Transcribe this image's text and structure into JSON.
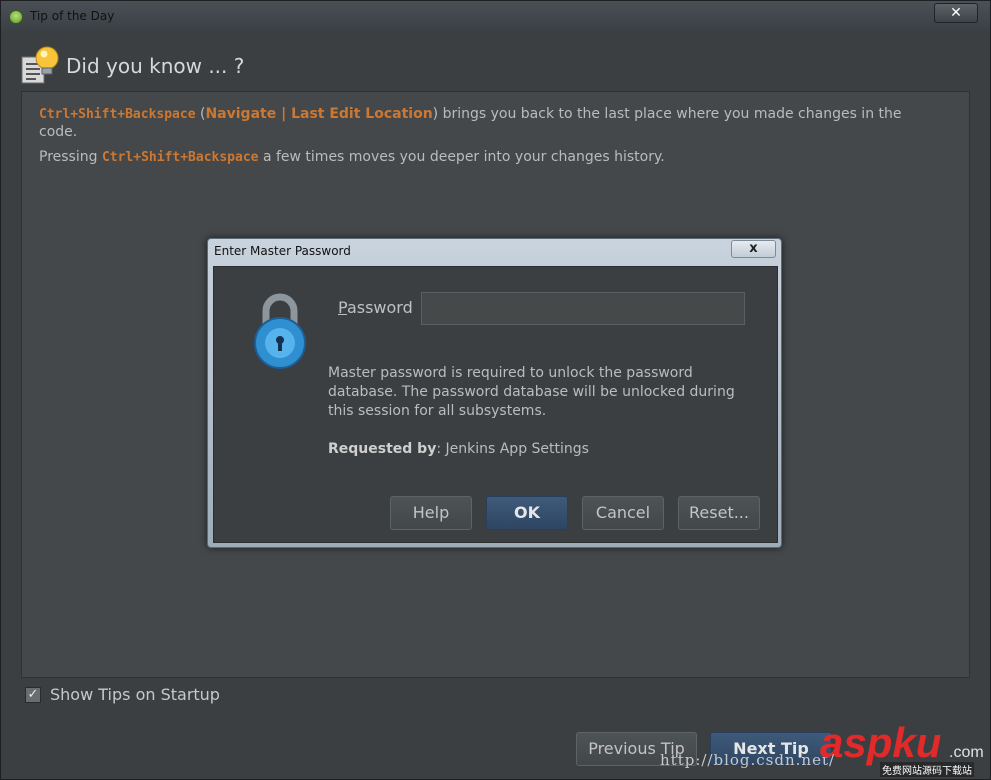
{
  "window": {
    "title": "Tip of the Day",
    "close_glyph": "✕"
  },
  "header": {
    "title": "Did you know ... ?"
  },
  "tip": {
    "shortcut": "Ctrl+Shift+Backspace",
    "paren_open": " (",
    "action": "Navigate | Last Edit Location",
    "paren_close": ")",
    "line1_rest": " brings you back to the last place where you made changes in the",
    "line1_cont": "code.",
    "line2_prefix": "Pressing ",
    "line2_rest": " a few times moves you deeper into your changes history."
  },
  "footer": {
    "show_tips_label": "Show Tips on Startup",
    "show_tips_checked": true,
    "previous_label": "Previous Tip",
    "next_label": "Next Tip"
  },
  "dialog": {
    "title": "Enter Master Password",
    "close_glyph": "x",
    "password_label_first": "P",
    "password_label_rest": "assword",
    "password_value": "",
    "message": "Master password is required to unlock the password database. The password database will be unlocked during this session for all subsystems.",
    "requested_by_label": "Requested by",
    "requested_by_value": ": Jenkins App Settings",
    "buttons": {
      "help": "Help",
      "ok": "OK",
      "cancel": "Cancel",
      "reset": "Reset..."
    }
  },
  "watermark": {
    "url": "http://blog.csdn.net/",
    "brand": "aspku",
    "brand_suffix": ".com",
    "slogan": "免费网站源码下载站"
  },
  "colors": {
    "accent_orange": "#cc7832",
    "primary_blue": "#2e4663",
    "panel": "#3c3f41"
  }
}
